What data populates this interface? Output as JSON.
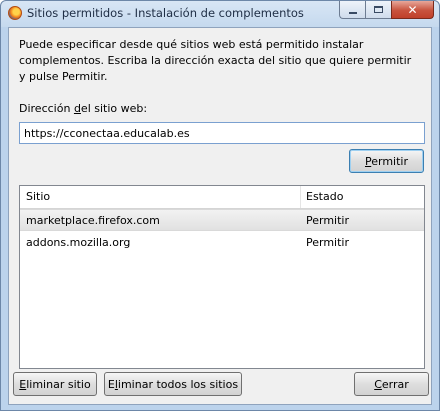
{
  "window": {
    "title": "Sitios permitidos - Instalación de complementos",
    "app_icon": "firefox-icon"
  },
  "dialog": {
    "description": "Puede especificar desde qué sitios web está permitido instalar complementos. Escriba la dirección exacta del sitio que quiere permitir y pulse Permitir.",
    "url_label": "Dirección del sitio web:",
    "url_value": "https://cconectaa.educalab.es",
    "permit_button": "Permitir"
  },
  "sites_table": {
    "columns": [
      "Sitio",
      "Estado"
    ],
    "rows": [
      {
        "site": "marketplace.firefox.com",
        "status": "Permitir",
        "selected": true
      },
      {
        "site": "addons.mozilla.org",
        "status": "Permitir",
        "selected": false
      }
    ]
  },
  "footer": {
    "remove_site": "Eliminar sitio",
    "remove_all": "Eliminar todos los sitios",
    "close": "Cerrar"
  }
}
